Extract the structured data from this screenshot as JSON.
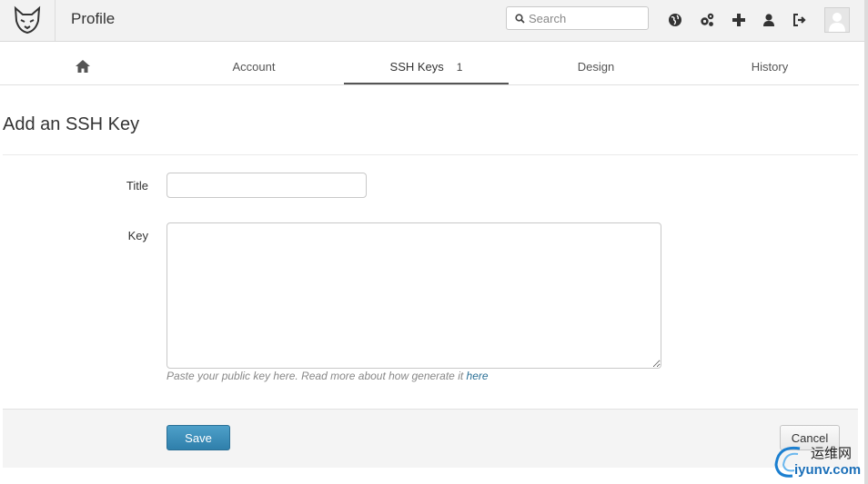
{
  "header": {
    "app_title": "Profile",
    "search_placeholder": "Search",
    "icons": [
      "globe-icon",
      "admin-gears-icon",
      "plus-icon",
      "user-icon",
      "logout-icon"
    ]
  },
  "tabs": [
    {
      "name": "home",
      "label": "",
      "icon": "home-icon"
    },
    {
      "name": "account",
      "label": "Account"
    },
    {
      "name": "ssh-keys",
      "label": "SSH Keys",
      "count": "1",
      "active": true
    },
    {
      "name": "design",
      "label": "Design"
    },
    {
      "name": "history",
      "label": "History"
    }
  ],
  "page": {
    "heading": "Add an SSH Key"
  },
  "form": {
    "title_label": "Title",
    "title_value": "",
    "key_label": "Key",
    "key_value": "",
    "hint_text": "Paste your public key here. Read more about how generate it ",
    "hint_link": "here"
  },
  "actions": {
    "save_label": "Save",
    "cancel_label": "Cancel"
  },
  "watermark": {
    "cn": "运维网",
    "url": "iyunv.com"
  },
  "colors": {
    "primary_button": "#2f7fab",
    "link": "#2a6f96",
    "header_bg": "#f2f2f2"
  }
}
